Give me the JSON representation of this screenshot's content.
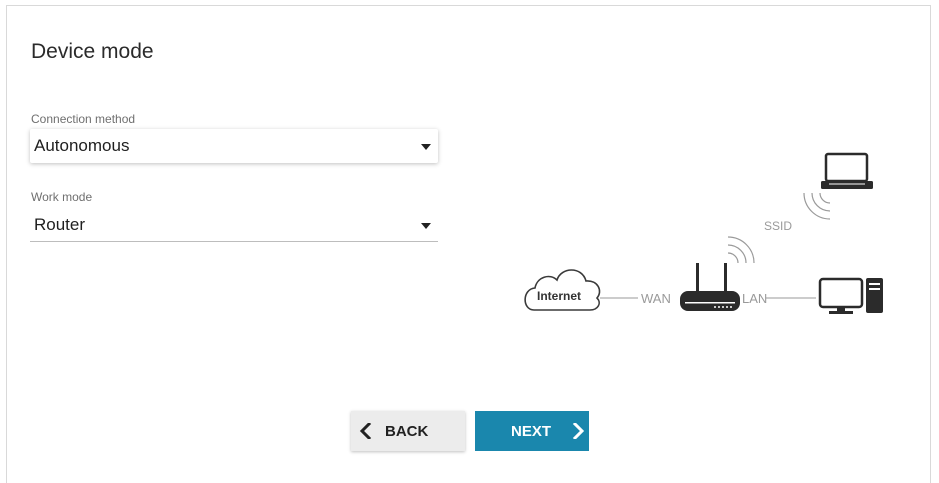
{
  "page": {
    "title": "Device mode"
  },
  "connection_method": {
    "label": "Connection method",
    "value": "Autonomous"
  },
  "work_mode": {
    "label": "Work mode",
    "value": "Router"
  },
  "diagram": {
    "internet_label": "Internet",
    "wan_label": "WAN",
    "lan_label": "LAN",
    "ssid_label": "SSID"
  },
  "buttons": {
    "back": "BACK",
    "next": "NEXT"
  },
  "colors": {
    "accent": "#1a87ad",
    "icon": "#2b2b2b"
  }
}
